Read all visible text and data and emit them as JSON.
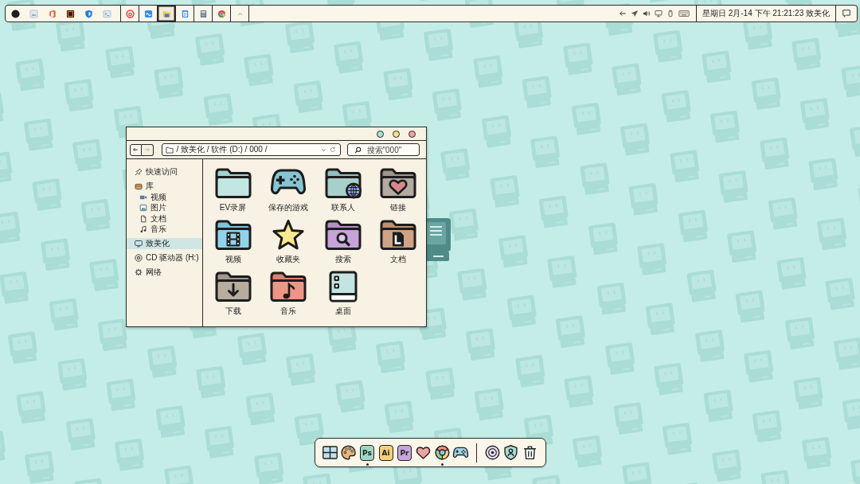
{
  "taskbar": {
    "groups": [
      {
        "apps": [
          {
            "kind": "circle",
            "active": false
          },
          {
            "kind": "image-file",
            "active": false
          },
          {
            "kind": "office",
            "active": false
          },
          {
            "kind": "dark-square",
            "active": false
          },
          {
            "kind": "shield",
            "active": false
          },
          {
            "kind": "terminal",
            "active": false
          }
        ]
      },
      {
        "apps": [
          {
            "kind": "swirl",
            "active": false
          }
        ]
      },
      {
        "apps": [
          {
            "kind": "wave",
            "active": false
          }
        ]
      },
      {
        "apps": [
          {
            "kind": "folder",
            "active": true
          }
        ]
      },
      {
        "apps": [
          {
            "kind": "notepad",
            "active": false
          }
        ]
      },
      {
        "apps": [
          {
            "kind": "calculator",
            "active": false
          }
        ]
      },
      {
        "apps": [
          {
            "kind": "tricolor",
            "active": false
          }
        ]
      },
      {
        "apps": [
          {
            "kind": "chevron",
            "active": false
          }
        ]
      }
    ],
    "tray": [
      {
        "kind": "arrow-left"
      },
      {
        "kind": "paper-plane"
      },
      {
        "kind": "speaker"
      },
      {
        "kind": "monitor"
      },
      {
        "kind": "mouse"
      },
      {
        "kind": "keyboard"
      }
    ],
    "clock": "星期日 2月-14 下午 21:21:23 致美化"
  },
  "window": {
    "nav": [
      {
        "kind": "back",
        "disabled": false
      },
      {
        "kind": "forward",
        "disabled": true
      }
    ],
    "address": "/ 致美化 / 软件 (D:) / 000 /",
    "search": {
      "placeholder": "搜索\"000\""
    },
    "sidebar": [
      {
        "label": "快速访问",
        "kind": "pin",
        "selected": false
      },
      {
        "label": "库",
        "kind": "library",
        "selected": false,
        "children": [
          {
            "label": "视频",
            "kind": "video",
            "selected": false
          },
          {
            "label": "图片",
            "kind": "image",
            "selected": false
          },
          {
            "label": "文档",
            "kind": "document",
            "selected": false
          },
          {
            "label": "音乐",
            "kind": "music",
            "selected": false
          }
        ]
      },
      {
        "label": "致美化",
        "kind": "monitor",
        "selected": true
      },
      {
        "label": "CD 驱动器 (H:)",
        "kind": "disc",
        "selected": false
      },
      {
        "label": "网络",
        "kind": "gear",
        "selected": false
      }
    ],
    "items": [
      {
        "label": "EV录屏",
        "kind": "folder"
      },
      {
        "label": "保存的游戏",
        "kind": "gamepad"
      },
      {
        "label": "联系人",
        "kind": "folder-globe"
      },
      {
        "label": "链接",
        "kind": "folder-heart"
      },
      {
        "label": "视频",
        "kind": "folder-film"
      },
      {
        "label": "收藏夹",
        "kind": "star"
      },
      {
        "label": "搜索",
        "kind": "folder-search"
      },
      {
        "label": "文档",
        "kind": "folder-document"
      },
      {
        "label": "下载",
        "kind": "folder-download"
      },
      {
        "label": "音乐",
        "kind": "folder-music"
      },
      {
        "label": "桌面",
        "kind": "desktop"
      }
    ]
  },
  "dock": {
    "apps": [
      {
        "kind": "grid-window",
        "running": false
      },
      {
        "kind": "palette",
        "running": false
      },
      {
        "kind": "tile",
        "text": "Ps",
        "color": "#9fd7c3",
        "running": true
      },
      {
        "kind": "tile",
        "text": "Ai",
        "color": "#f7cf7a",
        "running": false
      },
      {
        "kind": "tile",
        "text": "Pr",
        "color": "#c7a5dd",
        "running": false
      },
      {
        "kind": "heart",
        "running": false
      },
      {
        "kind": "tricolor",
        "running": true
      },
      {
        "kind": "gamepad",
        "running": false
      }
    ],
    "system": [
      {
        "kind": "disc"
      },
      {
        "kind": "shield-user"
      },
      {
        "kind": "trash"
      }
    ]
  }
}
